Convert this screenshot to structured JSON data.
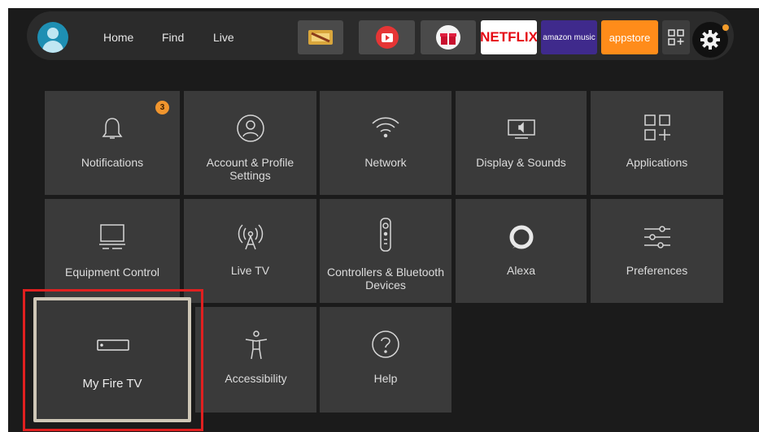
{
  "nav": {
    "links": [
      "Home",
      "Find",
      "Live"
    ],
    "apps": [
      {
        "name": "cinema-app",
        "label": ""
      },
      {
        "name": "youtube-app",
        "label": ""
      },
      {
        "name": "gift-app",
        "label": ""
      },
      {
        "name": "netflix-app",
        "label": "NETFLIX"
      },
      {
        "name": "amazon-music-app",
        "label": "amazon music"
      },
      {
        "name": "appstore-app",
        "label": "appstore"
      }
    ],
    "colors": {
      "netflix": "#e50914",
      "amazon_music": "#3f2a8c",
      "appstore": "#ff8c1a",
      "settings_dot": "#f39c2b"
    }
  },
  "tiles": {
    "notifications": {
      "label": "Notifications",
      "badge": "3",
      "icon": "bell-icon"
    },
    "account": {
      "label": "Account & Profile Settings",
      "icon": "user-circle-icon"
    },
    "network": {
      "label": "Network",
      "icon": "wifi-icon"
    },
    "display": {
      "label": "Display & Sounds",
      "icon": "tv-speaker-icon"
    },
    "applications": {
      "label": "Applications",
      "icon": "apps-grid-icon"
    },
    "equipment": {
      "label": "Equipment Control",
      "icon": "monitor-icon"
    },
    "livetv": {
      "label": "Live TV",
      "icon": "antenna-icon"
    },
    "controllers": {
      "label": "Controllers & Bluetooth Devices",
      "icon": "remote-icon"
    },
    "alexa": {
      "label": "Alexa",
      "icon": "alexa-ring-icon"
    },
    "preferences": {
      "label": "Preferences",
      "icon": "sliders-icon"
    },
    "myfiretv": {
      "label": "My Fire TV",
      "icon": "fire-tv-stick-icon"
    },
    "accessibility": {
      "label": "Accessibility",
      "icon": "accessibility-person-icon"
    },
    "help": {
      "label": "Help",
      "icon": "question-circle-icon"
    }
  }
}
